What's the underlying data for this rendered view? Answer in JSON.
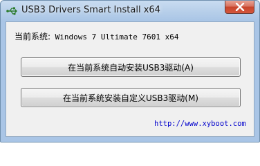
{
  "window": {
    "title": "USB3 Drivers Smart Install x64",
    "icon": "usb-icon",
    "close_icon": "close-icon"
  },
  "system": {
    "label": "当前系统:",
    "value": " Windows 7 Ultimate 7601 x64"
  },
  "buttons": {
    "auto_install": "在当前系统自动安装USB3驱动(A)",
    "custom_install": "在当前系统安装自定义USB3驱动(M)"
  },
  "footer": {
    "link": "http://www.xyboot.com"
  },
  "colors": {
    "link": "#0000cc",
    "close_button": "#c7442a"
  }
}
